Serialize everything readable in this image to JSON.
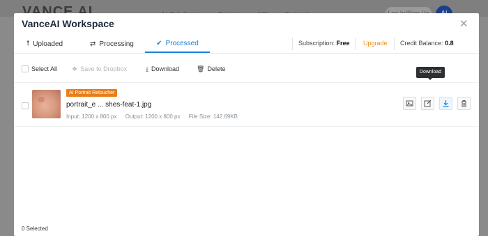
{
  "background": {
    "logo": "VANCE AI",
    "nav": [
      "AI Solutions",
      "Pricing",
      "API",
      "Support"
    ],
    "login": "Log In/Sign Up",
    "avatar": "AI"
  },
  "modal": {
    "title": "VanceAI Workspace",
    "close_icon": "close-icon"
  },
  "tabs": [
    {
      "label": "Uploaded",
      "icon": "arrow-up-icon",
      "active": false
    },
    {
      "label": "Processing",
      "icon": "sync-icon",
      "active": false
    },
    {
      "label": "Processed",
      "icon": "check-circle-icon",
      "active": true
    }
  ],
  "subscription": {
    "label": "Subscription:",
    "plan": "Free",
    "upgrade": "Upgrade",
    "credit_label": "Credit Balance:",
    "credit_value": "0.8"
  },
  "toolbar": {
    "select_all": "Select All",
    "save_dropbox": "Save to Dropbox",
    "download": "Download",
    "delete": "Delete"
  },
  "files": [
    {
      "badge": "AI Portrait Retoucher",
      "name": "portrait_e ... shes-feat-1.jpg",
      "input": "Input: 1200 x 800 px",
      "output": "Output: 1200 x 800 px",
      "size": "File Size: 142.69KB"
    }
  ],
  "tooltip": "Download",
  "footer": {
    "selected": "0  Selected"
  },
  "colors": {
    "accent": "#1a7fd6",
    "upgrade": "#f08c1a",
    "badge": "#e87f1a",
    "overlay": "#8a8a8a"
  }
}
